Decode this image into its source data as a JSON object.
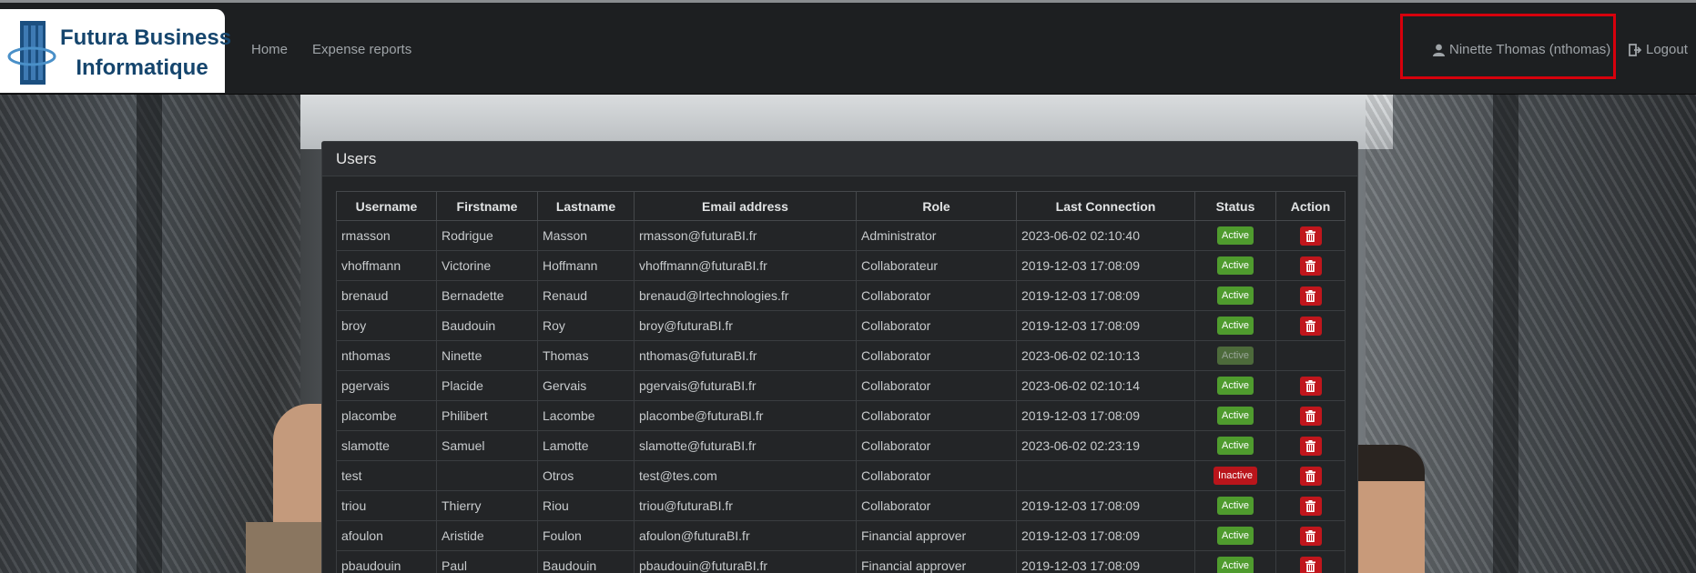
{
  "navbar": {
    "brand_line1": "Futura Business",
    "brand_line2": "Informatique",
    "links": [
      "Home",
      "Expense reports"
    ],
    "user": "Ninette Thomas (nthomas)",
    "logout": "Logout"
  },
  "panel": {
    "title": "Users",
    "columns": [
      "Username",
      "Firstname",
      "Lastname",
      "Email address",
      "Role",
      "Last Connection",
      "Status",
      "Action"
    ],
    "rows": [
      {
        "username": "rmasson",
        "firstname": "Rodrigue",
        "lastname": "Masson",
        "email": "rmasson@futuraBI.fr",
        "role": "Administrator",
        "last": "2023-06-02 02:10:40",
        "status": "Active",
        "delete": true
      },
      {
        "username": "vhoffmann",
        "firstname": "Victorine",
        "lastname": "Hoffmann",
        "email": "vhoffmann@futuraBI.fr",
        "role": "Collaborateur",
        "last": "2019-12-03 17:08:09",
        "status": "Active",
        "delete": true
      },
      {
        "username": "brenaud",
        "firstname": "Bernadette",
        "lastname": "Renaud",
        "email": "brenaud@lrtechnologies.fr",
        "role": "Collaborator",
        "last": "2019-12-03 17:08:09",
        "status": "Active",
        "delete": true
      },
      {
        "username": "broy",
        "firstname": "Baudouin",
        "lastname": "Roy",
        "email": "broy@futuraBI.fr",
        "role": "Collaborator",
        "last": "2019-12-03 17:08:09",
        "status": "Active",
        "delete": true
      },
      {
        "username": "nthomas",
        "firstname": "Ninette",
        "lastname": "Thomas",
        "email": "nthomas@futuraBI.fr",
        "role": "Collaborator",
        "last": "2023-06-02 02:10:13",
        "status": "Active",
        "delete": false
      },
      {
        "username": "pgervais",
        "firstname": "Placide",
        "lastname": "Gervais",
        "email": "pgervais@futuraBI.fr",
        "role": "Collaborator",
        "last": "2023-06-02 02:10:14",
        "status": "Active",
        "delete": true
      },
      {
        "username": "placombe",
        "firstname": "Philibert",
        "lastname": "Lacombe",
        "email": "placombe@futuraBI.fr",
        "role": "Collaborator",
        "last": "2019-12-03 17:08:09",
        "status": "Active",
        "delete": true
      },
      {
        "username": "slamotte",
        "firstname": "Samuel",
        "lastname": "Lamotte",
        "email": "slamotte@futuraBI.fr",
        "role": "Collaborator",
        "last": "2023-06-02 02:23:19",
        "status": "Active",
        "delete": true
      },
      {
        "username": "test",
        "firstname": "",
        "lastname": "Otros",
        "email": "test@tes.com",
        "role": "Collaborator",
        "last": "",
        "status": "Inactive",
        "delete": true
      },
      {
        "username": "triou",
        "firstname": "Thierry",
        "lastname": "Riou",
        "email": "triou@futuraBI.fr",
        "role": "Collaborator",
        "last": "2019-12-03 17:08:09",
        "status": "Active",
        "delete": true
      },
      {
        "username": "afoulon",
        "firstname": "Aristide",
        "lastname": "Foulon",
        "email": "afoulon@futuraBI.fr",
        "role": "Financial approver",
        "last": "2019-12-03 17:08:09",
        "status": "Active",
        "delete": true
      },
      {
        "username": "pbaudouin",
        "firstname": "Paul",
        "lastname": "Baudouin",
        "email": "pbaudouin@futuraBI.fr",
        "role": "Financial approver",
        "last": "2019-12-03 17:08:09",
        "status": "Active",
        "delete": true
      }
    ]
  },
  "icons": {
    "user": "user-icon",
    "logout": "logout-icon",
    "delete": "trash-icon"
  },
  "colors": {
    "active": "#4f9b2e",
    "inactive": "#b9151b",
    "highlight": "#d7000c"
  }
}
